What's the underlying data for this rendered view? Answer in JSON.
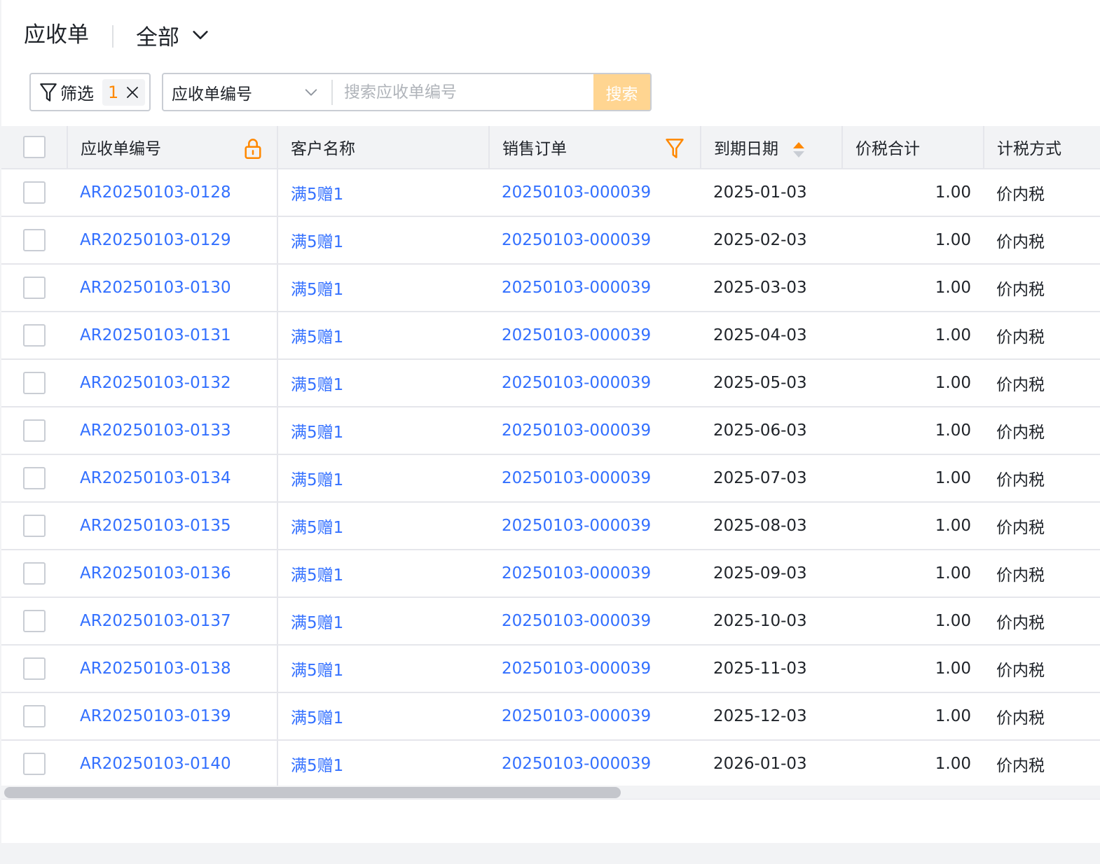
{
  "header": {
    "title": "应收单",
    "view_label": "全部"
  },
  "toolbar": {
    "filter_label": "筛选",
    "filter_count": "1",
    "search_field": "应收单编号",
    "search_placeholder": "搜索应收单编号",
    "search_button": "搜索"
  },
  "table": {
    "columns": [
      "应收单编号",
      "客户名称",
      "销售订单",
      "到期日期",
      "价税合计",
      "计税方式"
    ],
    "rows": [
      {
        "ar": "AR20250103-0128",
        "customer": "满5赠1",
        "order": "20250103-000039",
        "due": "2025-01-03",
        "total": "1.00",
        "tax": "价内税"
      },
      {
        "ar": "AR20250103-0129",
        "customer": "满5赠1",
        "order": "20250103-000039",
        "due": "2025-02-03",
        "total": "1.00",
        "tax": "价内税"
      },
      {
        "ar": "AR20250103-0130",
        "customer": "满5赠1",
        "order": "20250103-000039",
        "due": "2025-03-03",
        "total": "1.00",
        "tax": "价内税"
      },
      {
        "ar": "AR20250103-0131",
        "customer": "满5赠1",
        "order": "20250103-000039",
        "due": "2025-04-03",
        "total": "1.00",
        "tax": "价内税"
      },
      {
        "ar": "AR20250103-0132",
        "customer": "满5赠1",
        "order": "20250103-000039",
        "due": "2025-05-03",
        "total": "1.00",
        "tax": "价内税"
      },
      {
        "ar": "AR20250103-0133",
        "customer": "满5赠1",
        "order": "20250103-000039",
        "due": "2025-06-03",
        "total": "1.00",
        "tax": "价内税"
      },
      {
        "ar": "AR20250103-0134",
        "customer": "满5赠1",
        "order": "20250103-000039",
        "due": "2025-07-03",
        "total": "1.00",
        "tax": "价内税"
      },
      {
        "ar": "AR20250103-0135",
        "customer": "满5赠1",
        "order": "20250103-000039",
        "due": "2025-08-03",
        "total": "1.00",
        "tax": "价内税"
      },
      {
        "ar": "AR20250103-0136",
        "customer": "满5赠1",
        "order": "20250103-000039",
        "due": "2025-09-03",
        "total": "1.00",
        "tax": "价内税"
      },
      {
        "ar": "AR20250103-0137",
        "customer": "满5赠1",
        "order": "20250103-000039",
        "due": "2025-10-03",
        "total": "1.00",
        "tax": "价内税"
      },
      {
        "ar": "AR20250103-0138",
        "customer": "满5赠1",
        "order": "20250103-000039",
        "due": "2025-11-03",
        "total": "1.00",
        "tax": "价内税"
      },
      {
        "ar": "AR20250103-0139",
        "customer": "满5赠1",
        "order": "20250103-000039",
        "due": "2025-12-03",
        "total": "1.00",
        "tax": "价内税"
      },
      {
        "ar": "AR20250103-0140",
        "customer": "满5赠1",
        "order": "20250103-000039",
        "due": "2026-01-03",
        "total": "1.00",
        "tax": "价内税"
      }
    ]
  },
  "icons": {
    "view_dropdown": "chevron-down-icon",
    "filter": "funnel-icon",
    "clear_filter": "close-icon",
    "search_field_dropdown": "chevron-down-icon",
    "column_lock": "lock-icon",
    "column_filter": "funnel-icon",
    "column_sort": "sort-icon"
  },
  "colors": {
    "link": "#3370ff",
    "accent_orange": "#ff8800",
    "search_button_bg": "#ffd591",
    "header_bg": "#f2f3f5"
  }
}
